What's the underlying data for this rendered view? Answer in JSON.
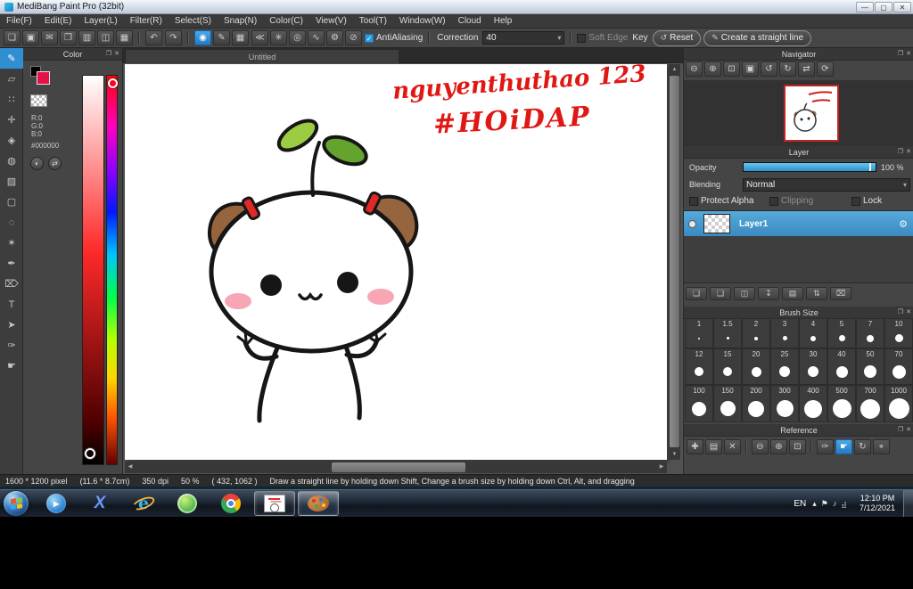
{
  "glyphs": {
    "caret": "▾",
    "check": "✓",
    "gear": "⚙"
  },
  "panel_chrome": {
    "float_icon": "❐",
    "close_icon": "✕"
  },
  "scrollbar": {
    "up": "▲",
    "down": "▼",
    "left": "◀",
    "right": "▶"
  },
  "window": {
    "title": "MediBang Paint Pro (32bit)",
    "controls": [
      {
        "name": "minimize-button",
        "glyph": "—"
      },
      {
        "name": "maximize-button",
        "glyph": "▢"
      },
      {
        "name": "close-button",
        "glyph": "✕"
      }
    ]
  },
  "menu": {
    "items": [
      "File(F)",
      "Edit(E)",
      "Layer(L)",
      "Filter(R)",
      "Select(S)",
      "Snap(N)",
      "Color(C)",
      "View(V)",
      "Tool(T)",
      "Window(W)",
      "Cloud",
      "Help"
    ]
  },
  "toolbar": {
    "file_icons": [
      {
        "name": "new-canvas-icon",
        "glyph": "❏"
      },
      {
        "name": "save-icon",
        "glyph": "▣"
      },
      {
        "name": "publish-icon",
        "glyph": "✉"
      },
      {
        "name": "open-icon",
        "glyph": "❐"
      },
      {
        "name": "export-icon",
        "glyph": "▥"
      },
      {
        "name": "split-view-icon",
        "glyph": "◫"
      },
      {
        "name": "materials-icon",
        "glyph": "▦"
      }
    ],
    "undo_icon": {
      "name": "undo-icon",
      "glyph": "↶"
    },
    "redo_icon": {
      "name": "redo-icon",
      "glyph": "↷"
    },
    "brush_icons": [
      {
        "name": "brush-type-icon",
        "glyph": "◉",
        "active": true
      },
      {
        "name": "pen-icon",
        "glyph": "✎"
      },
      {
        "name": "grid-snap-icon",
        "glyph": "▦"
      }
    ],
    "snap_icons": [
      {
        "name": "parallel-snap-icon",
        "glyph": "≪"
      },
      {
        "name": "cross-snap-icon",
        "glyph": "✳"
      },
      {
        "name": "radial-snap-icon",
        "glyph": "◎"
      },
      {
        "name": "curve-snap-icon",
        "glyph": "∿"
      },
      {
        "name": "snap-settings-icon",
        "glyph": "⚙"
      },
      {
        "name": "snap-off-icon",
        "glyph": "⊘"
      }
    ],
    "antialiasing_label": "AntiAliasing",
    "correction_label": "Correction",
    "correction_value": "40",
    "soft_edge_label": "Soft Edge",
    "key_label": "Key",
    "reset_label": "Reset",
    "reset_icon_glyph": "↺",
    "straight_line_label": "Create a straight line",
    "straight_line_icon_glyph": "✎"
  },
  "tools": {
    "items": [
      {
        "name": "brush-tool",
        "glyph": "✎",
        "active": true
      },
      {
        "name": "eraser-tool",
        "glyph": "▱"
      },
      {
        "name": "dot-tool",
        "glyph": "∷"
      },
      {
        "name": "move-tool",
        "glyph": "✛"
      },
      {
        "name": "fill-tool",
        "glyph": "◈"
      },
      {
        "name": "bucket-tool",
        "glyph": "◍"
      },
      {
        "name": "gradient-tool",
        "glyph": "▨"
      },
      {
        "name": "select-tool",
        "glyph": "▢"
      },
      {
        "name": "lasso-tool",
        "glyph": "◌"
      },
      {
        "name": "magic-wand-tool",
        "glyph": "✶"
      },
      {
        "name": "select-pen-tool",
        "glyph": "✒"
      },
      {
        "name": "select-eraser-tool",
        "glyph": "⌦"
      },
      {
        "name": "text-tool",
        "glyph": "T"
      },
      {
        "name": "operation-tool",
        "glyph": "➤"
      },
      {
        "name": "eyedropper-tool",
        "glyph": "✑"
      },
      {
        "name": "hand-tool",
        "glyph": "☛"
      }
    ]
  },
  "color_panel": {
    "title": "Color",
    "r": "R:0",
    "g": "G:0",
    "b": "B:0",
    "hex": "#000000",
    "fore_swatch_color": "#e81048",
    "back_swatch_color": "#000000",
    "icons": [
      {
        "name": "color-wheel-icon",
        "glyph": "◐"
      },
      {
        "name": "swap-colors-icon",
        "glyph": "⇄"
      }
    ]
  },
  "canvas": {
    "tab_title": "Untitled",
    "signature_line1": "nguyenthuthao 123",
    "signature_line2": "#HOiDAP",
    "signature_color": "#e01814"
  },
  "navigator": {
    "title": "Navigator",
    "icons": [
      {
        "name": "zoom-out-icon",
        "glyph": "⊖"
      },
      {
        "name": "zoom-in-icon",
        "glyph": "⊕"
      },
      {
        "name": "zoom-fit-icon",
        "glyph": "⊡"
      },
      {
        "name": "zoom-actual-icon",
        "glyph": "▣"
      },
      {
        "name": "rotate-ccw-icon",
        "glyph": "↺"
      },
      {
        "name": "rotate-cw-icon",
        "glyph": "↻"
      },
      {
        "name": "flip-icon",
        "glyph": "⇄"
      },
      {
        "name": "reset-view-icon",
        "glyph": "⟳"
      }
    ]
  },
  "layer_panel": {
    "title": "Layer",
    "opacity_label": "Opacity",
    "opacity_value": "100 %",
    "opacity_percent": 100,
    "blending_label": "Blending",
    "blending_value": "Normal",
    "protect_alpha_label": "Protect Alpha",
    "clipping_label": "Clipping",
    "lock_label": "Lock",
    "layers": [
      {
        "name": "Layer1",
        "selected": true
      }
    ],
    "buttons": [
      {
        "name": "add-layer-icon",
        "glyph": "❏"
      },
      {
        "name": "add-layer-menu-icon",
        "glyph": "❑"
      },
      {
        "name": "duplicate-layer-icon",
        "glyph": "◫"
      },
      {
        "name": "import-layer-icon",
        "glyph": "↧"
      },
      {
        "name": "folder-icon",
        "glyph": "▤"
      },
      {
        "name": "merge-layer-icon",
        "glyph": "⇅"
      },
      {
        "name": "delete-layer-icon",
        "glyph": "⌧"
      }
    ]
  },
  "brush_size_panel": {
    "title": "Brush Size",
    "sizes": [
      "1",
      "1.5",
      "2",
      "3",
      "4",
      "5",
      "7",
      "10",
      "12",
      "15",
      "20",
      "25",
      "30",
      "40",
      "50",
      "70",
      "100",
      "150",
      "200",
      "300",
      "400",
      "500",
      "700",
      "1000"
    ]
  },
  "reference_panel": {
    "title": "Reference",
    "icons": [
      {
        "name": "add-reference-icon",
        "glyph": "✚"
      },
      {
        "name": "open-folder-icon",
        "glyph": "▤"
      },
      {
        "name": "close-icon",
        "glyph": "✕"
      },
      {
        "sep": true
      },
      {
        "name": "zoom-out-icon",
        "glyph": "⊖"
      },
      {
        "name": "zoom-in-icon",
        "glyph": "⊕"
      },
      {
        "name": "zoom-fit-icon",
        "glyph": "⊡"
      },
      {
        "sep": true
      },
      {
        "name": "eyedropper-icon",
        "glyph": "✑"
      },
      {
        "name": "hand-icon",
        "glyph": "☛",
        "active": true
      },
      {
        "name": "rotate-icon",
        "glyph": "↻"
      },
      {
        "name": "pin-icon",
        "glyph": "⌖"
      }
    ]
  },
  "status_bar": {
    "segments": [
      "1600 * 1200 pixel",
      "(11.6 * 8.7cm)",
      "350 dpi",
      "50 %",
      "( 432, 1062 )",
      "Draw a straight line by holding down Shift, Change a brush size by holding down Ctrl, Alt, and dragging"
    ]
  },
  "taskbar": {
    "apps": [
      {
        "name": "media-player",
        "icon": "wmp",
        "glyph": "▸"
      },
      {
        "name": "x-app",
        "icon": "xapp",
        "glyph": "X"
      },
      {
        "name": "internet-explorer",
        "icon": "ie",
        "glyph": "e"
      },
      {
        "name": "coccoc-browser",
        "icon": "coccoc"
      },
      {
        "name": "chrome",
        "icon": "chrome"
      },
      {
        "name": "medibang-document",
        "icon": "docthumb",
        "active": true
      },
      {
        "name": "medibang-paint",
        "icon": "palette",
        "active": true,
        "focused": true
      }
    ],
    "language": "EN",
    "tray_icons": [
      {
        "name": "tray-expand-icon",
        "glyph": "▴"
      },
      {
        "name": "action-center-icon",
        "glyph": "⚑"
      },
      {
        "name": "volume-icon",
        "glyph": "♪"
      },
      {
        "name": "network-icon",
        "glyph": "⣴"
      }
    ],
    "time": "12:10 PM",
    "date": "7/12/2021"
  }
}
